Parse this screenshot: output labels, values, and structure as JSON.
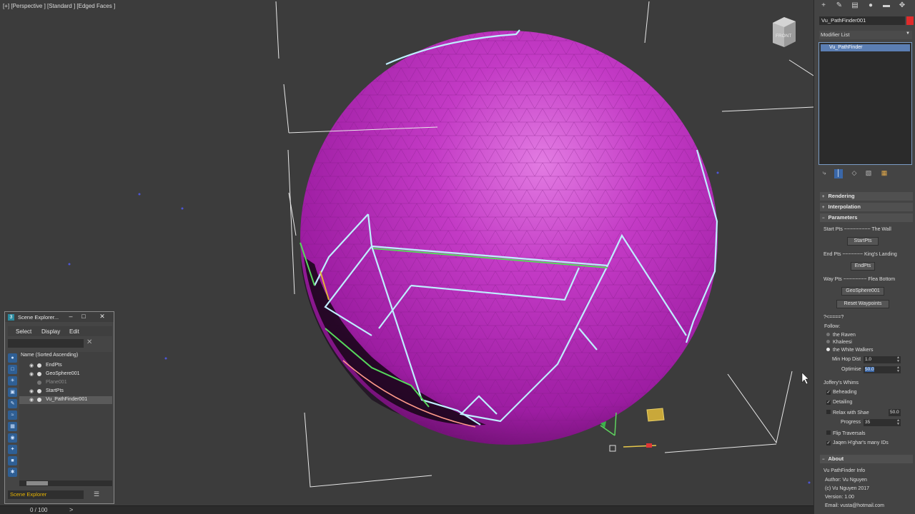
{
  "viewport": {
    "label": "[+] [Perspective ] [Standard ] [Edged Faces ]",
    "viewcube_label": "FRONT"
  },
  "timeline": {
    "counter": "0 / 100",
    "next_arrow": ">"
  },
  "command_panel": {
    "tabs": [
      "plus-icon",
      "curve-icon",
      "hierarchy-icon",
      "motion-icon",
      "display-icon",
      "utilities-icon"
    ],
    "object_name": "Vu_PathFinder001",
    "object_color": "#e02b2b",
    "modifier_list_label": "Modifier List",
    "modifier_stack": [
      "Vu_PathFinder"
    ],
    "rollouts": {
      "rendering": "Rendering",
      "interpolation": "Interpolation",
      "parameters": "Parameters",
      "about": "About"
    },
    "params": {
      "start_pts_label": "Start Pts ~~~~~~~~~ The Wall",
      "start_pts_button": "StartPts",
      "end_pts_label": "End Pts ~~~~~~~ King's Landing",
      "end_pts_button": "EndPts",
      "way_pts_label": "Way Pts ~~~~~~~~ Flea Bottom",
      "way_pts_button": "GeoSphere001",
      "reset_button": "Reset Waypoints",
      "separator": "?<====?",
      "follow_label": "Follow:",
      "follow_options": [
        "the Raven",
        "Khaleesi",
        "the White Walkers"
      ],
      "follow_selected": 2,
      "min_hop_label": "Min Hop Dist",
      "min_hop_value": "1.0",
      "optimise_label": "Optimise",
      "optimise_value": "50.0",
      "whims_label": "Joffery's Whims",
      "beheading": "Beheading",
      "detailing": "Detailing",
      "relax_label": "Relax with Shae",
      "relax_value": "50.0",
      "progress_label": "Progress",
      "progress_value": "35",
      "flip": "Flip Traversals",
      "jaqen": "Jaqen H'ghar's many IDs"
    },
    "about": {
      "title": "Vu PathFinder Info",
      "author": "Author: Vu Nguyen",
      "copyright": "(c) Vu Nguyen 2017",
      "version": "Version: 1.00",
      "email": "Email: vusta@hotmail.com"
    }
  },
  "scene_explorer": {
    "title": "Scene Explorer...",
    "menu": [
      "Select",
      "Display",
      "Edit"
    ],
    "column_header": "Name (Sorted Ascending)",
    "rows": [
      {
        "name": "EndPts",
        "state": "normal"
      },
      {
        "name": "GeoSphere001",
        "state": "normal"
      },
      {
        "name": "Plane001",
        "state": "dim"
      },
      {
        "name": "StartPts",
        "state": "normal"
      },
      {
        "name": "Vu_PathFinder001",
        "state": "selected"
      }
    ],
    "footer": "Scene Explorer"
  }
}
